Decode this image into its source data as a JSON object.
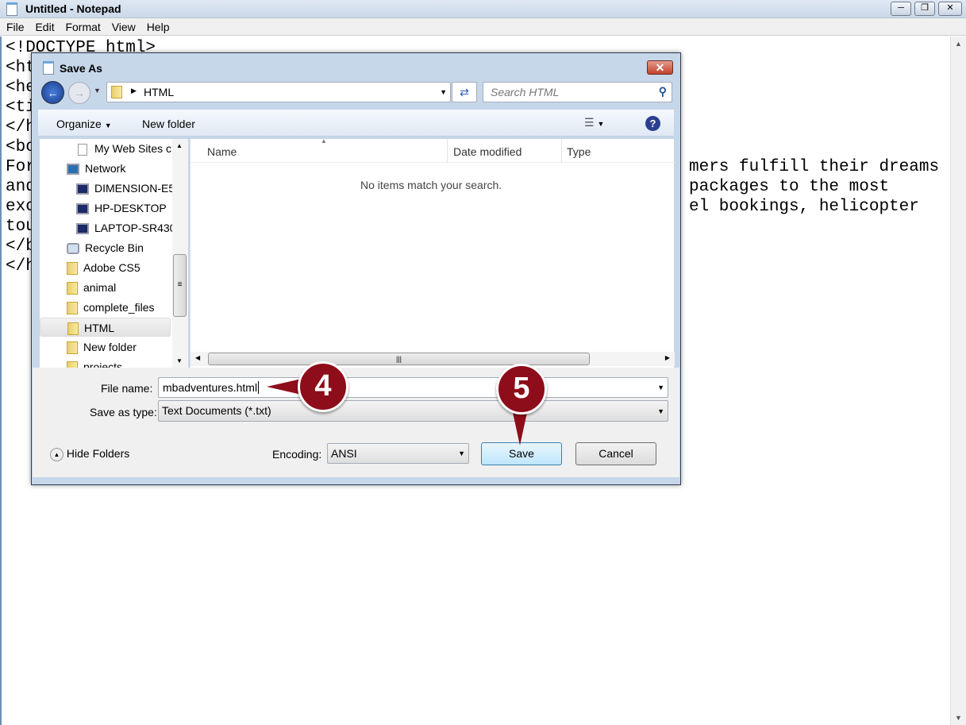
{
  "notepad": {
    "title": "Untitled - Notepad",
    "menu": [
      "File",
      "Edit",
      "Format",
      "View",
      "Help"
    ],
    "left_lines": [
      "<!DOCTYPE html>",
      "<ht",
      "<he",
      "<ti",
      "</h",
      "<bo",
      "For",
      "and",
      "exc",
      "tou",
      "</b",
      "</h"
    ],
    "right_lines": [
      "mers fulfill their dreams",
      "packages to the most",
      "el bookings, helicopter"
    ]
  },
  "dialog": {
    "title": "Save As",
    "address": "HTML",
    "search_placeholder": "Search HTML",
    "toolbar": {
      "organize": "Organize",
      "new_folder": "New folder"
    },
    "nav_items": [
      "My Web Sites c",
      "Network",
      "DIMENSION-E5",
      "HP-DESKTOP",
      "LAPTOP-SR430",
      "Recycle Bin",
      "Adobe CS5",
      "animal",
      "complete_files",
      "HTML",
      "New folder",
      "projects"
    ],
    "columns": [
      "Name",
      "Date modified",
      "Type"
    ],
    "empty_message": "No items match your search.",
    "file_name_label": "File name:",
    "file_name": "mbadventures.html",
    "save_type_label": "Save as type:",
    "save_type": "Text Documents (*.txt)",
    "hide_folders": "Hide Folders",
    "encoding_label": "Encoding:",
    "encoding": "ANSI",
    "save": "Save",
    "cancel": "Cancel"
  },
  "callouts": [
    "4",
    "5"
  ],
  "colors": {
    "callout": "#8e0d1b",
    "close_button": "#c75050"
  }
}
